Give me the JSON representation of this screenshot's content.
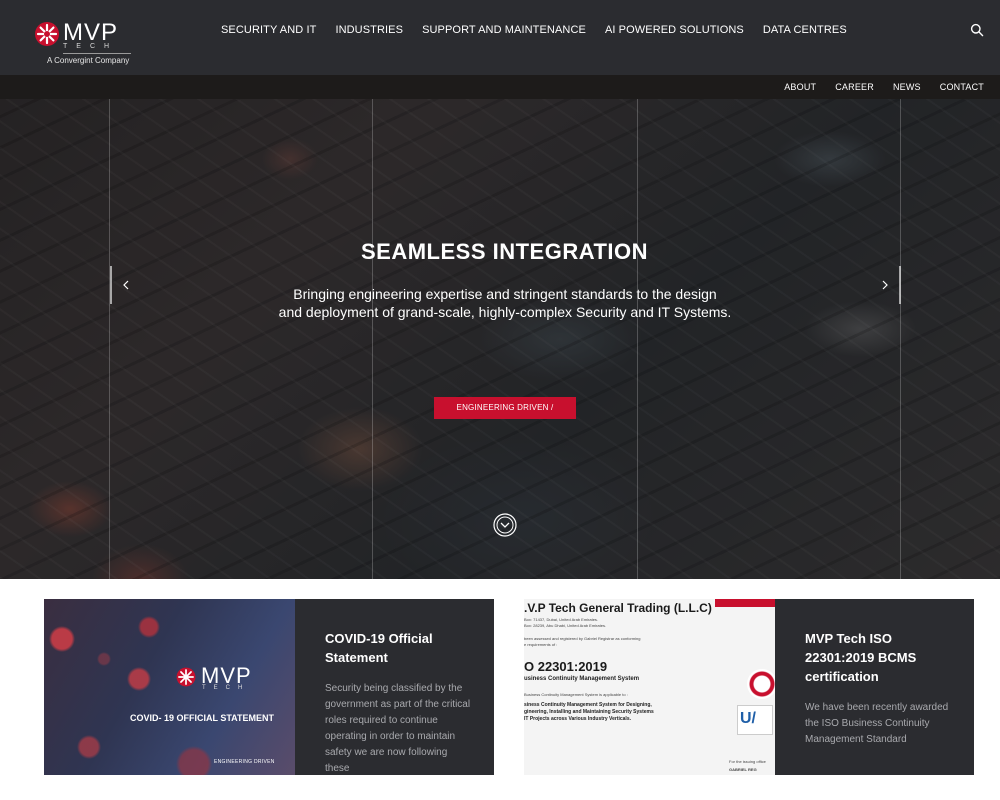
{
  "brand": {
    "logo_text": "MVP",
    "logo_sub": "TECH",
    "company_line": "A Convergint Company",
    "accent_color": "#c8102e"
  },
  "main_nav": [
    {
      "label": "SECURITY AND IT"
    },
    {
      "label": "INDUSTRIES"
    },
    {
      "label": "SUPPORT AND MAINTENANCE"
    },
    {
      "label": "AI POWERED SOLUTIONS"
    },
    {
      "label": "DATA CENTRES"
    }
  ],
  "search_icon": "search-icon",
  "sub_nav": [
    {
      "label": "ABOUT"
    },
    {
      "label": "CAREER"
    },
    {
      "label": "NEWS"
    },
    {
      "label": "CONTACT"
    }
  ],
  "hero": {
    "title": "SEAMLESS INTEGRATION",
    "line1": "Bringing engineering expertise and stringent standards to the design",
    "line2": "and deployment of grand-scale, highly-complex Security and IT Systems.",
    "cta": "ENGINEERING DRIVEN /",
    "prev_icon": "chevron-left-icon",
    "next_icon": "chevron-right-icon",
    "scroll_icon": "chevron-down-circle-icon"
  },
  "cards": [
    {
      "image": {
        "logo_text": "MVP",
        "logo_sub": "TECH",
        "heading": "COVID- 19 OFFICIAL STATEMENT",
        "tag": "ENGINEERING DRIVEN"
      },
      "title_line1": "COVID-19 Official",
      "title_line2": "Statement",
      "text": "Security being classified by the government as part of the critical roles required to continue operating in order to maintain safety we are now following these"
    },
    {
      "image": {
        "heading": ".V.P Tech General Trading (L.L.C)",
        "line1": "Box: 71437, Dubai, United Arab Emirates.",
        "line2": "Box: 28239, Abu Dhabi, United Arab Emirates.",
        "line3": "been assessed and registered by Gabriel Registrar as conforming",
        "line4": "e requirements of :",
        "iso": "O 22301:2019",
        "bcms": "usiness Continuity Management System",
        "line5": "Business Continuity Management System is applicable to :",
        "scope1": "siness Continuity Management System for Designing,",
        "scope2": "gineering, Installing and Maintaining Security Systems",
        "scope3": "IT Projects across Various Industry Verticals.",
        "seal_text": "U/",
        "footer1": "For the issuing office",
        "footer2": "GABRIEL REG"
      },
      "title_line1": "MVP Tech ISO",
      "title_line2": "22301:2019 BCMS",
      "title_line3": "certification",
      "text": "We have been recently awarded the ISO Business Continuity Management Standard"
    }
  ]
}
